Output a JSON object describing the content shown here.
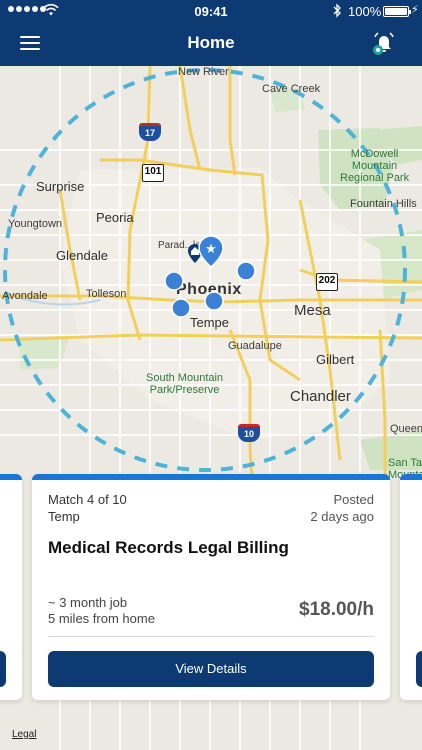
{
  "status_bar": {
    "time": "09:41",
    "battery_percent": "100%"
  },
  "nav": {
    "title": "Home"
  },
  "map": {
    "labels": {
      "new_river": "New River",
      "cave_creek": "Cave Creek",
      "mcdowell": "McDowell\nMountain\nRegional Park",
      "surprise": "Surprise",
      "fountain_hills": "Fountain Hills",
      "youngtown": "Youngtown",
      "peoria": "Peoria",
      "glendale": "Glendale",
      "paradise_valley": "Parad...ley",
      "avondale": "Avondale",
      "tolleson": "Tolleson",
      "phoenix": "Phoenix",
      "tempe": "Tempe",
      "mesa": "Mesa",
      "guadalupe": "Guadalupe",
      "gilbert": "Gilbert",
      "south_mountain": "South Mountain\nPark/Preserve",
      "chandler": "Chandler",
      "queen_creek": "Queen",
      "san_tan": "San Ta\nMounta"
    },
    "shields": {
      "i17": "17",
      "loop101": "101",
      "loop202": "202",
      "i10": "10"
    }
  },
  "cards": [
    {
      "match": "Match 4 of 10",
      "type": "Temp",
      "posted_label": "Posted",
      "posted_ago": "2 days ago",
      "title": "Medical Records Legal Billing",
      "duration": "~ 3 month job",
      "distance": "5 miles from home",
      "pay": "$18.00/h",
      "button": "View Details"
    }
  ],
  "footer": {
    "legal": "Legal"
  },
  "colors": {
    "nav_bg": "#0d3a72",
    "card_band": "#1976d2",
    "pin": "#3b82d6",
    "radius_ring": "#4fb3d9"
  }
}
